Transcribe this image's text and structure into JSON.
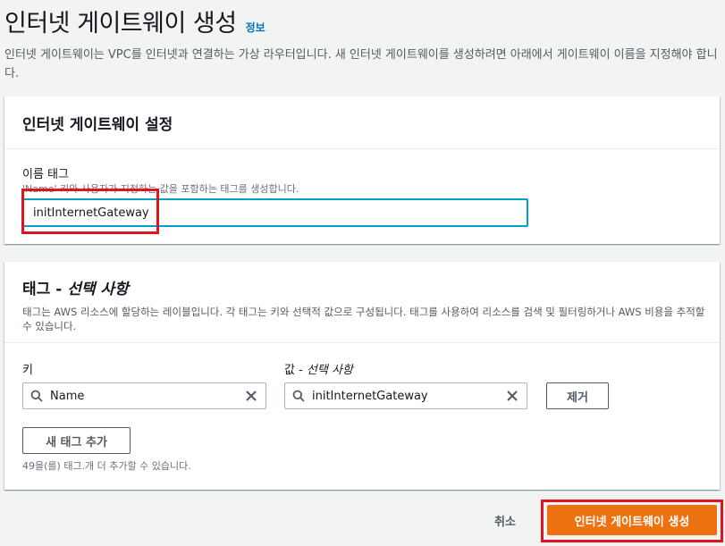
{
  "header": {
    "title": "인터넷 게이트웨이 생성",
    "info_link": "정보",
    "description": "인터넷 게이트웨이는 VPC를 인터넷과 연결하는 가상 라우터입니다. 새 인터넷 게이트웨이를 생성하려면 아래에서 게이트웨이 이름을 지정해야 합니다."
  },
  "settings_card": {
    "title": "인터넷 게이트웨이 설정",
    "name_tag_label": "이름 태그",
    "name_tag_hint": "'Name' 키와 사용자가 지정하는 값을 포함하는 태그를 생성합니다.",
    "name_tag_value": "initInternetGateway"
  },
  "tags_card": {
    "title_prefix": "태그 - ",
    "title_optional": "선택 사항",
    "description": "태그는 AWS 리소스에 할당하는 레이블입니다. 각 태그는 키와 선택적 값으로 구성됩니다. 태그를 사용하여 리소스를 검색 및 필터링하거나 AWS 비용을 추적할 수 있습니다.",
    "key_label": "키",
    "value_label_prefix": "값 - ",
    "value_label_optional": "선택 사항",
    "key_value": "Name",
    "value_value": "initInternetGateway",
    "remove_button": "제거",
    "add_tag_button": "새 태그 추가",
    "remaining_hint": "49을(를) 태그.개 더 추가할 수 있습니다."
  },
  "footer": {
    "cancel_label": "취소",
    "create_button": "인터넷 게이트웨이 생성"
  },
  "colors": {
    "primary": "#ec7211",
    "link": "#0073bb",
    "focus": "#00a1c9",
    "annotation": "#e0141e"
  }
}
